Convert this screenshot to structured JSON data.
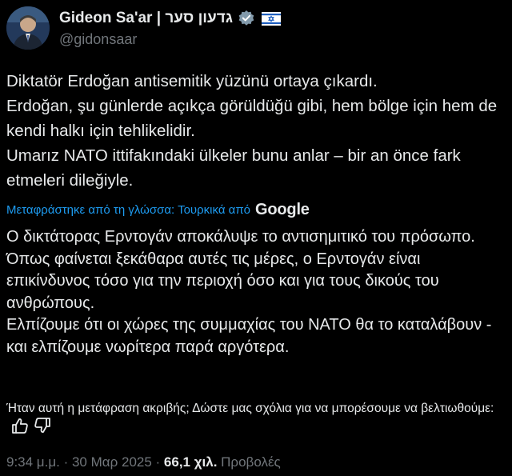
{
  "author": {
    "display_name": "Gideon Sa'ar | גדעון סער",
    "handle": "@gidonsaar"
  },
  "tweet": {
    "lines": [
      "Diktatör Erdoğan antisemitik yüzünü ortaya çıkardı.",
      "Erdoğan, şu günlerde açıkça görüldüğü gibi, hem bölge için hem de kendi halkı için tehlikelidir.",
      "Umarız NATO ittifakındaki ülkeler bunu anlar – bir an önce fark etmeleri dileğiyle."
    ]
  },
  "translation": {
    "label": "Μεταφράστηκε από τη γλώσσα: Τουρκικά από",
    "provider": "Google",
    "lines": [
      "Ο δικτάτορας Ερντογάν αποκάλυψε το αντισημιτικό του πρόσωπο.",
      "Όπως φαίνεται ξεκάθαρα αυτές τις μέρες, ο Ερντογάν είναι επικίνδυνος τόσο για την περιοχή όσο και για τους δικούς του ανθρώπους.",
      "Ελπίζουμε ότι οι χώρες της συμμαχίας του ΝΑΤΟ θα το καταλάβουν - και ελπίζουμε νωρίτερα παρά αργότερα."
    ],
    "feedback_prompt": "Ήταν αυτή η μετάφραση ακριβής; Δώστε μας σχόλια για να μπορέσουμε να βελτιωθούμε:"
  },
  "meta": {
    "time": "9:34 μ.μ.",
    "separator": " · ",
    "date": "30 Μαρ 2025",
    "views_count": "66,1 χιλ.",
    "views_label": " Προβολές"
  },
  "icons": {
    "verified": "verified-badge-icon",
    "flag": "israel-flag-icon",
    "thumbs_up": "thumbs-up-icon",
    "thumbs_down": "thumbs-down-icon"
  },
  "colors": {
    "background": "#000000",
    "text": "#e7e9ea",
    "secondary": "#71767b",
    "link": "#1d9bf0",
    "verified_badge": "#829aab"
  }
}
